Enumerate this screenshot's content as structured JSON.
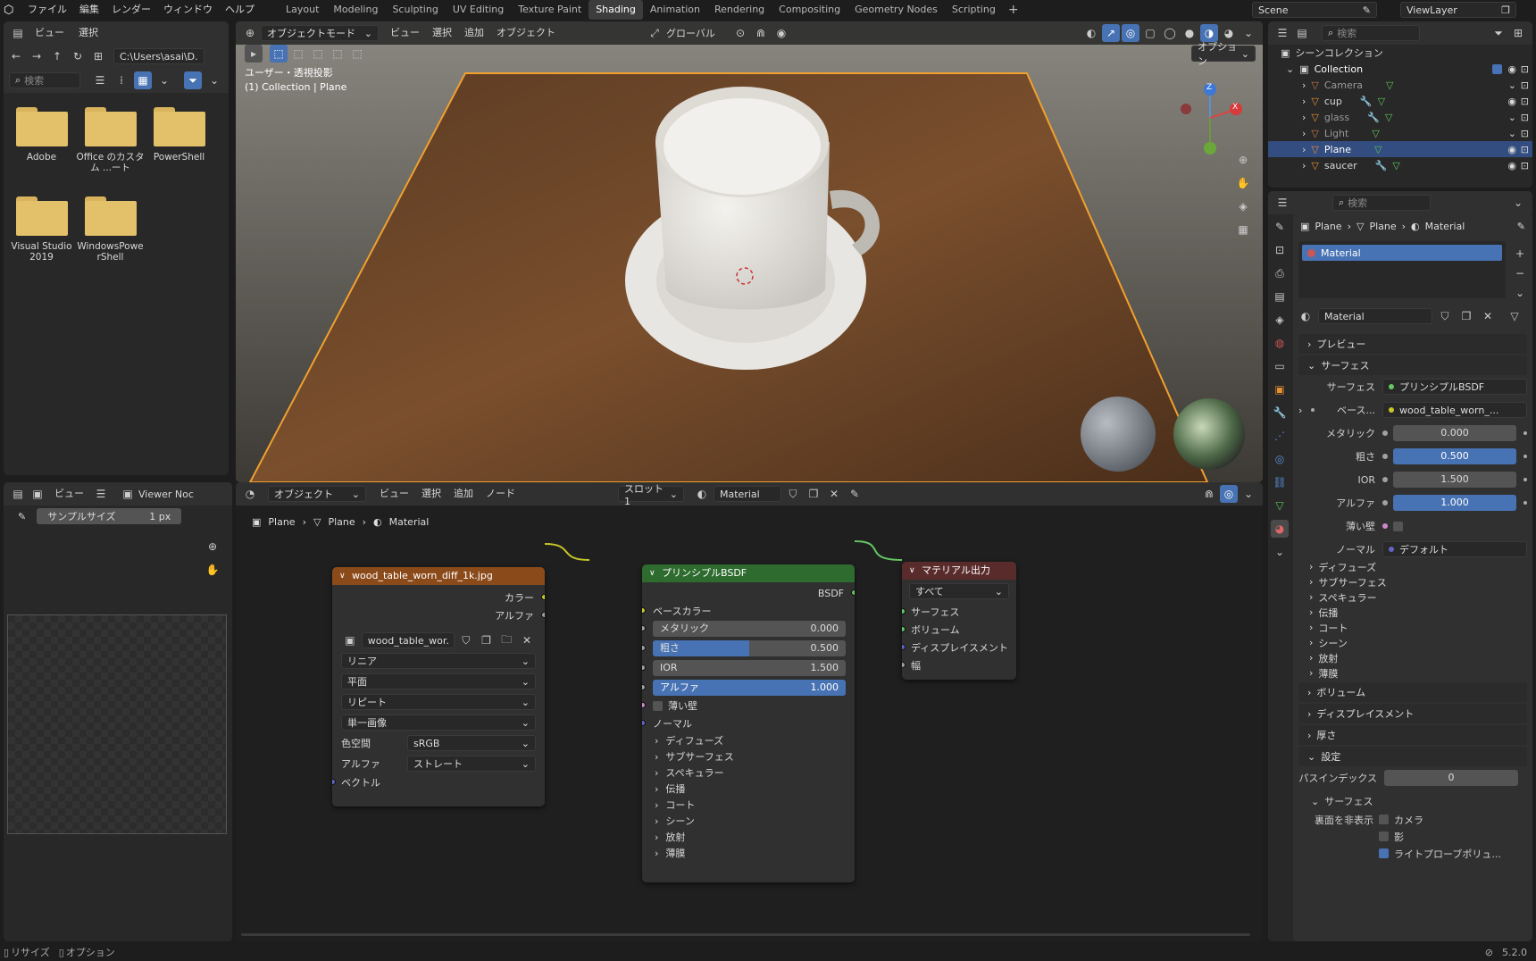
{
  "topbar": {
    "menus": [
      "ファイル",
      "編集",
      "レンダー",
      "ウィンドウ",
      "ヘルプ"
    ],
    "workspaces": [
      "Layout",
      "Modeling",
      "Sculpting",
      "UV Editing",
      "Texture Paint",
      "Shading",
      "Animation",
      "Rendering",
      "Compositing",
      "Geometry Nodes",
      "Scripting"
    ],
    "active_workspace": "Shading",
    "scene": "Scene",
    "view_layer": "ViewLayer"
  },
  "filebrowser": {
    "menus": [
      "ビュー",
      "選択"
    ],
    "path": "C:\\Users\\asai\\D...",
    "search_placeholder": "検索",
    "folders": [
      "Adobe",
      "Office のカスタム ...ート",
      "PowerShell",
      "Visual Studio 2019",
      "WindowsPowerShell"
    ]
  },
  "viewport": {
    "mode": "オブジェクトモード",
    "menus": [
      "ビュー",
      "選択",
      "追加",
      "オブジェクト"
    ],
    "transform": "グローバル",
    "options": "オプション",
    "view_label": "ユーザー・透視投影",
    "collection_label": "(1) Collection | Plane",
    "axes": {
      "x": "X",
      "y": "Y",
      "z": "Z"
    }
  },
  "imageeditor": {
    "menu": "ビュー",
    "viewer": "Viewer Noc",
    "sample_label": "サンプルサイズ",
    "sample_value": "1 px"
  },
  "nodeeditor": {
    "mode": "オブジェクト",
    "menus": [
      "ビュー",
      "選択",
      "追加",
      "ノード"
    ],
    "slot": "スロット1",
    "material": "Material",
    "breadcrumb": [
      "Plane",
      "Plane",
      "Material"
    ],
    "image_node": {
      "title": "wood_table_worn_diff_1k.jpg",
      "out_color": "カラー",
      "out_alpha": "アルファ",
      "image_name": "wood_table_wor...",
      "interp": "リニア",
      "proj": "平面",
      "ext": "リピート",
      "source": "単一画像",
      "colorspace_label": "色空間",
      "colorspace": "sRGB",
      "alpha_label": "アルファ",
      "alpha": "ストレート",
      "vector": "ベクトル"
    },
    "bsdf_node": {
      "title": "プリンシプルBSDF",
      "out": "BSDF",
      "base_color": "ベースカラー",
      "metallic_label": "メタリック",
      "metallic": "0.000",
      "roughness_label": "粗さ",
      "roughness": "0.500",
      "roughness_fill": 0.5,
      "ior_label": "IOR",
      "ior": "1.500",
      "alpha_label": "アルファ",
      "alpha": "1.000",
      "thin": "薄い壁",
      "normal": "ノーマル",
      "subs": [
        "ディフューズ",
        "サブサーフェス",
        "スペキュラー",
        "伝播",
        "コート",
        "シーン",
        "放射",
        "薄膜"
      ]
    },
    "output_node": {
      "title": "マテリアル出力",
      "target": "すべて",
      "inputs": [
        "サーフェス",
        "ボリューム",
        "ディスプレイスメント",
        "幅"
      ]
    }
  },
  "outliner": {
    "search_placeholder": "検索",
    "root": "シーンコレクション",
    "collection": "Collection",
    "items": [
      {
        "name": "Camera",
        "selected": false
      },
      {
        "name": "cup",
        "selected": false
      },
      {
        "name": "glass",
        "selected": false
      },
      {
        "name": "Light",
        "selected": false
      },
      {
        "name": "Plane",
        "selected": true
      },
      {
        "name": "saucer",
        "selected": false
      }
    ]
  },
  "properties": {
    "search_placeholder": "検索",
    "breadcrumb": [
      "Plane",
      "Plane",
      "Material"
    ],
    "slot": "Material",
    "material_name": "Material",
    "sections": {
      "preview": "プレビュー",
      "surface": "サーフェス",
      "volume": "ボリューム",
      "displacement": "ディスプレイスメント",
      "thickness": "厚さ",
      "settings": "設定"
    },
    "surface_label": "サーフェス",
    "surface_value": "プリンシプルBSDF",
    "base_label": "ベース...",
    "base_value": "wood_table_worn_...",
    "metallic_label": "メタリック",
    "metallic": "0.000",
    "roughness_label": "粗さ",
    "roughness": "0.500",
    "ior_label": "IOR",
    "ior": "1.500",
    "alpha_label": "アルファ",
    "alpha": "1.000",
    "thin_label": "薄い壁",
    "normal_label": "ノーマル",
    "normal_value": "デフォルト",
    "subs": [
      "ディフューズ",
      "サブサーフェス",
      "スペキュラー",
      "伝播",
      "コート",
      "シーン",
      "放射",
      "薄膜"
    ],
    "pass_label": "パスインデックス",
    "pass_value": "0",
    "surface_sub": "サーフェス",
    "backface_label": "裏面を非表示",
    "cb": [
      {
        "label": "カメラ",
        "on": false
      },
      {
        "label": "影",
        "on": false
      },
      {
        "label": "ライトプローブポリュ...",
        "on": true
      }
    ]
  },
  "statusbar": {
    "left1": "リサイズ",
    "left2": "オプション",
    "version": "5.2.0"
  }
}
